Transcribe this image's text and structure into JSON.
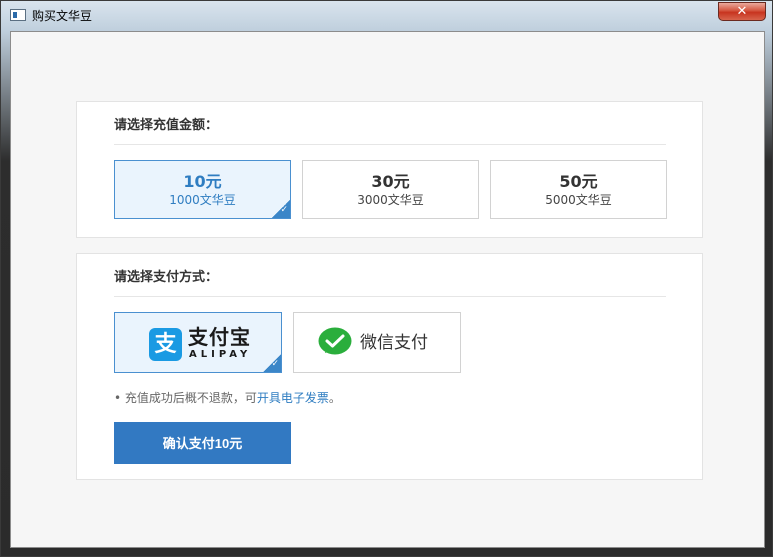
{
  "window": {
    "title": "购买文华豆",
    "close_label": "✕"
  },
  "amount_section": {
    "title": "请选择充值金额：",
    "options": [
      {
        "price": "10元",
        "beans": "1000文华豆",
        "selected": true
      },
      {
        "price": "30元",
        "beans": "3000文华豆",
        "selected": false
      },
      {
        "price": "50元",
        "beans": "5000文华豆",
        "selected": false
      }
    ]
  },
  "payment_section": {
    "title": "请选择支付方式：",
    "alipay": {
      "logo_glyph": "支",
      "name_cn": "支付宝",
      "name_en": "ALIPAY",
      "selected": true
    },
    "wechat": {
      "name": "微信支付",
      "selected": false
    },
    "note_prefix": "• 充值成功后概不退款，可",
    "note_link": "开具电子发票",
    "note_suffix": "。",
    "confirm_label": "确认支付10元"
  },
  "colors": {
    "accent": "#3279c2",
    "selected_bg": "#eaf4fd",
    "alipay_blue": "#1a9ae3",
    "wechat_green": "#2aae3c"
  },
  "icons": {
    "app": "app-window-icon",
    "check": "check-icon",
    "alipay": "alipay-logo-icon",
    "wechat": "wechat-logo-icon",
    "close": "close-icon"
  }
}
